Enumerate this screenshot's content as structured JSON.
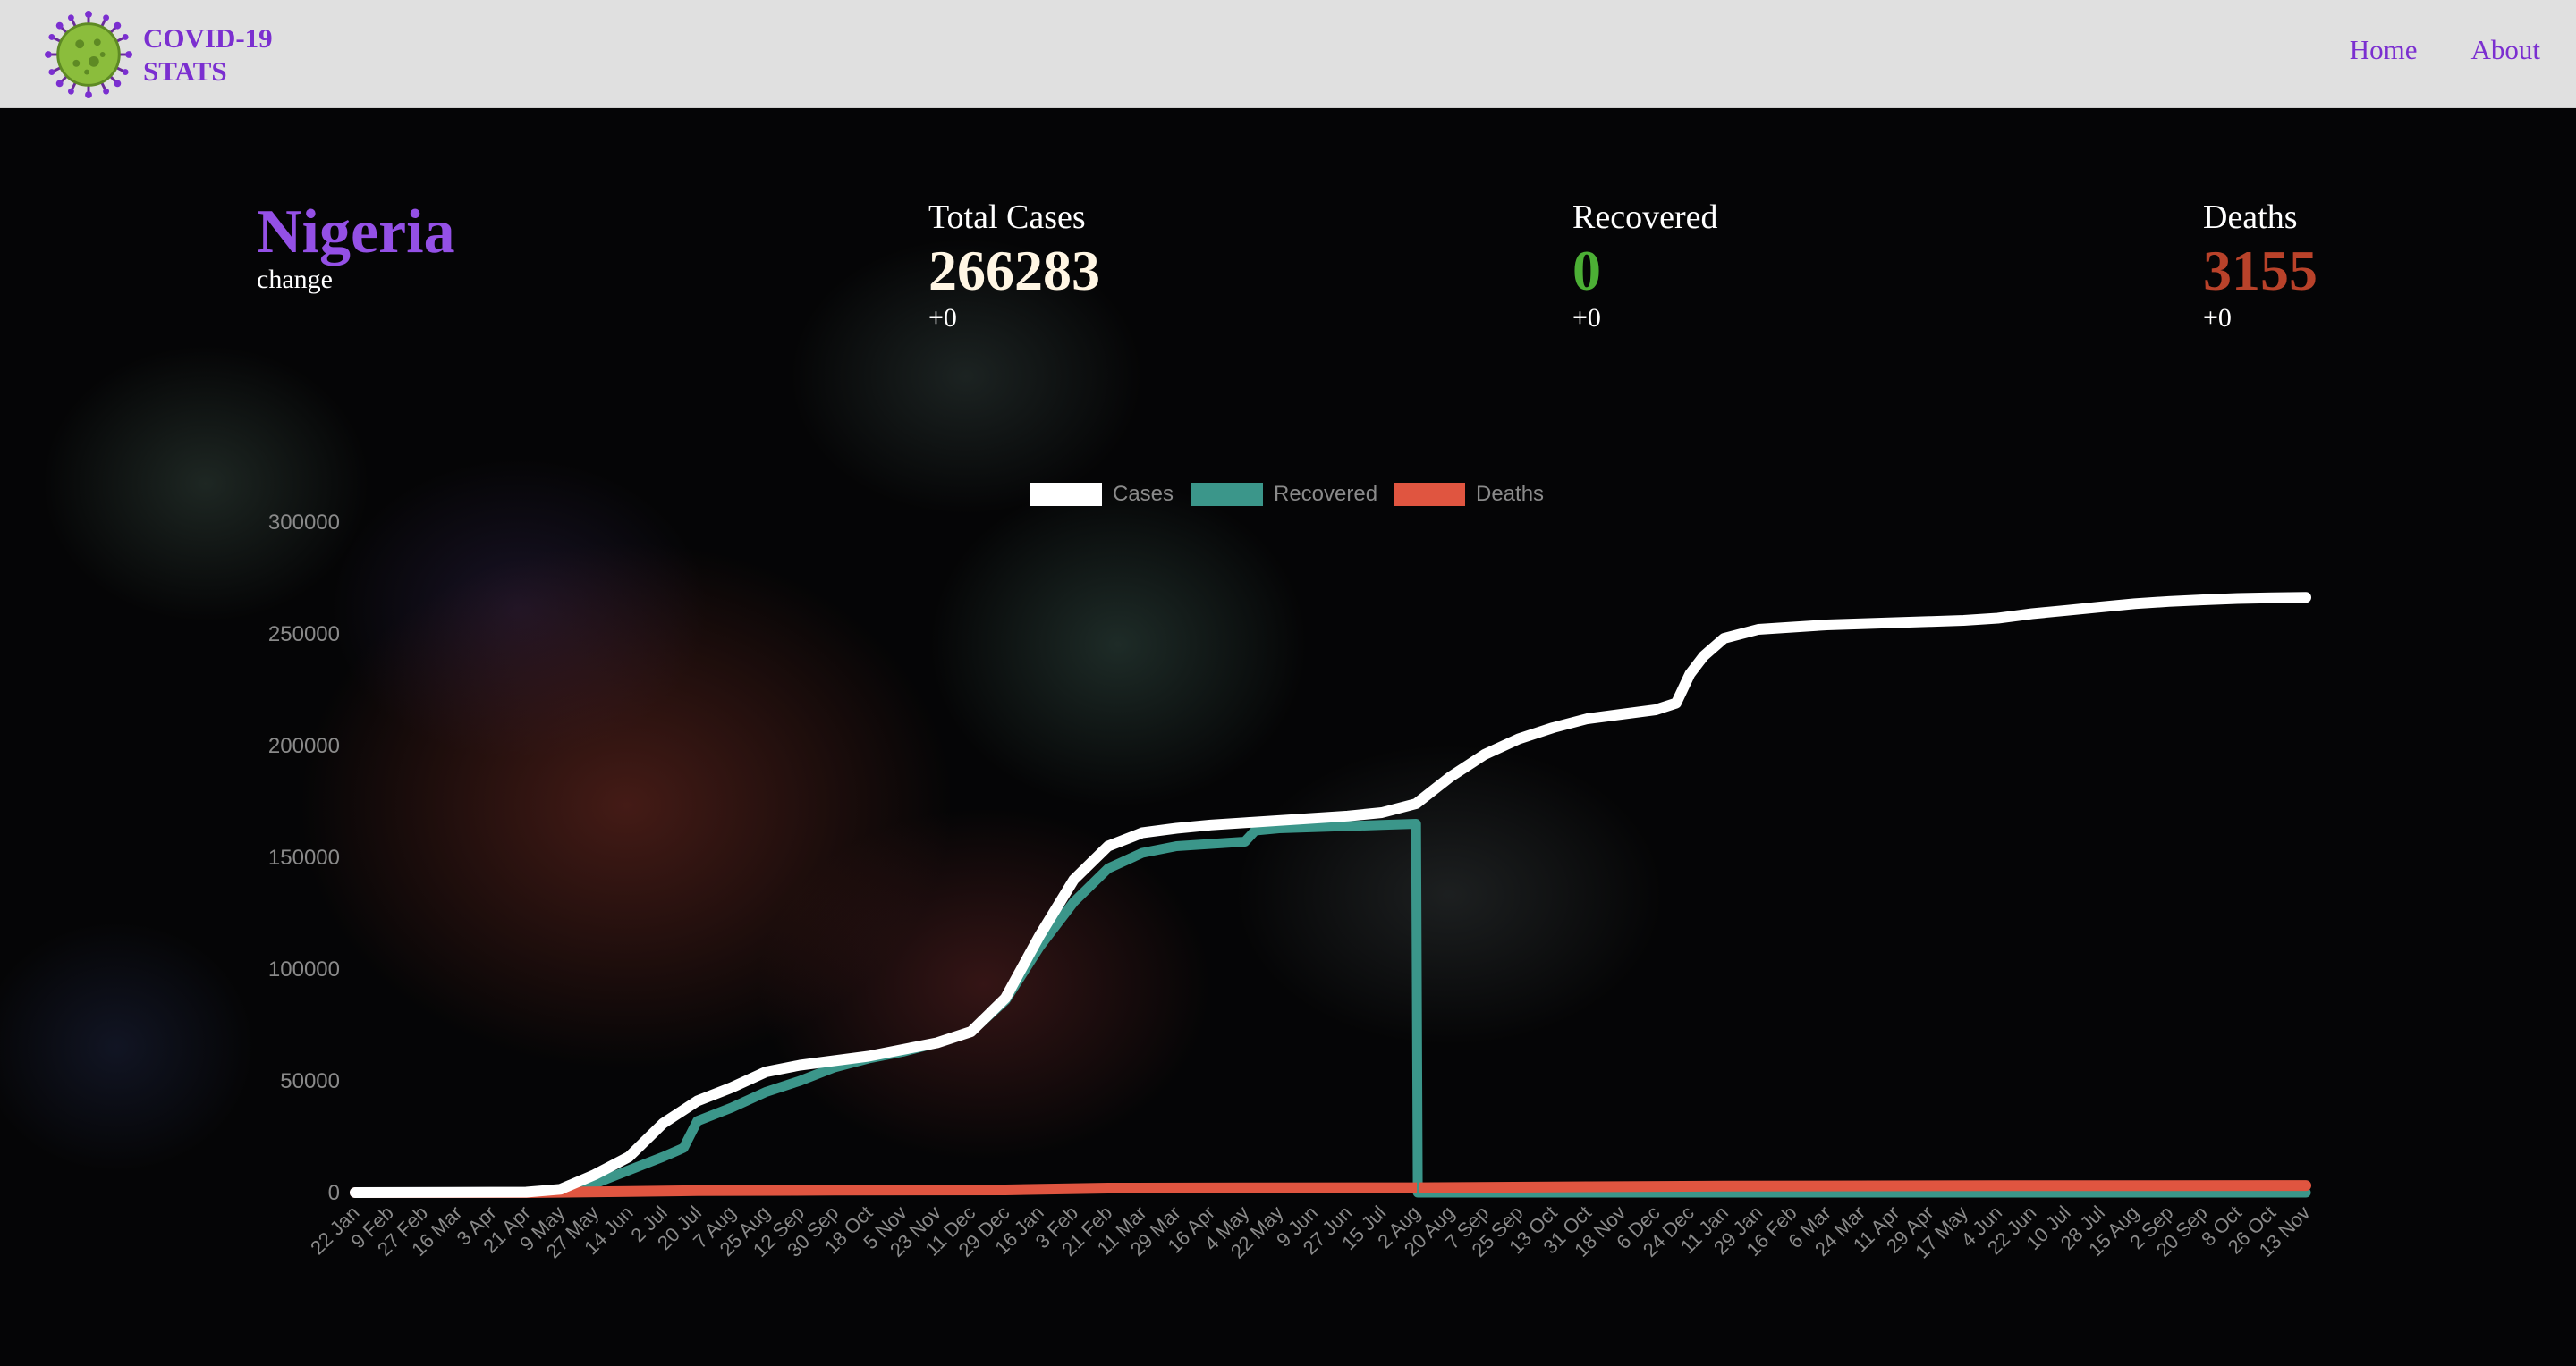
{
  "navbar": {
    "brand_line1": "COVID-19",
    "brand_line2": "STATS",
    "links": [
      "Home",
      "About"
    ]
  },
  "country": {
    "name": "Nigeria",
    "change_label": "change"
  },
  "stats": {
    "cases": {
      "label": "Total Cases",
      "value": "266283",
      "delta": "+0"
    },
    "recovered": {
      "label": "Recovered",
      "value": "0",
      "delta": "+0"
    },
    "deaths": {
      "label": "Deaths",
      "value": "3155",
      "delta": "+0"
    }
  },
  "colors": {
    "brand": "#7b2fd0",
    "cases": "#ffffff",
    "recovered": "#3b968a",
    "deaths": "#e05540"
  },
  "chart_data": {
    "type": "line",
    "grid": false,
    "legend_position": "top",
    "ylim": [
      0,
      300000
    ],
    "yticks": [
      0,
      50000,
      100000,
      150000,
      200000,
      250000,
      300000
    ],
    "xticks": [
      "22 Jan",
      "9 Feb",
      "27 Feb",
      "16 Mar",
      "3 Apr",
      "21 Apr",
      "9 May",
      "27 May",
      "14 Jun",
      "2 Jul",
      "20 Jul",
      "7 Aug",
      "25 Aug",
      "12 Sep",
      "30 Sep",
      "18 Oct",
      "5 Nov",
      "23 Nov",
      "11 Dec",
      "29 Dec",
      "16 Jan",
      "3 Feb",
      "21 Feb",
      "11 Mar",
      "29 Mar",
      "16 Apr",
      "4 May",
      "22 May",
      "9 Jun",
      "27 Jun",
      "15 Jul",
      "2 Aug",
      "20 Aug",
      "7 Sep",
      "25 Sep",
      "13 Oct",
      "31 Oct",
      "18 Nov",
      "6 Dec",
      "24 Dec",
      "11 Jan",
      "29 Jan",
      "16 Feb",
      "6 Mar",
      "24 Mar",
      "11 Apr",
      "29 Apr",
      "17 May",
      "4 Jun",
      "22 Jun",
      "10 Jul",
      "28 Jul",
      "15 Aug",
      "2 Sep",
      "20 Sep",
      "8 Oct",
      "26 Oct",
      "13 Nov"
    ],
    "series": [
      {
        "name": "Cases",
        "color": "#ffffff",
        "points": [
          [
            0,
            0
          ],
          [
            5,
            200
          ],
          [
            6,
            1500
          ],
          [
            7,
            8000
          ],
          [
            8,
            16000
          ],
          [
            9,
            31000
          ],
          [
            10,
            41000
          ],
          [
            11,
            47000
          ],
          [
            12,
            54000
          ],
          [
            13,
            57000
          ],
          [
            14,
            59000
          ],
          [
            15,
            61000
          ],
          [
            16,
            64000
          ],
          [
            17,
            67000
          ],
          [
            18,
            72000
          ],
          [
            19,
            87000
          ],
          [
            20,
            115000
          ],
          [
            21,
            140000
          ],
          [
            22,
            155000
          ],
          [
            23,
            161000
          ],
          [
            24,
            163000
          ],
          [
            25,
            164500
          ],
          [
            26,
            165500
          ],
          [
            27,
            166500
          ],
          [
            28,
            167500
          ],
          [
            29,
            168500
          ],
          [
            30,
            170000
          ],
          [
            31,
            174000
          ],
          [
            32,
            186000
          ],
          [
            33,
            196000
          ],
          [
            34,
            203000
          ],
          [
            35,
            208000
          ],
          [
            36,
            212000
          ],
          [
            37,
            214000
          ],
          [
            38,
            216000
          ],
          [
            38.6,
            219000
          ],
          [
            39,
            232000
          ],
          [
            39.4,
            240000
          ],
          [
            40,
            248000
          ],
          [
            41,
            252000
          ],
          [
            42,
            253000
          ],
          [
            43,
            254000
          ],
          [
            44,
            254500
          ],
          [
            45,
            255000
          ],
          [
            46,
            255500
          ],
          [
            47,
            256000
          ],
          [
            48,
            257000
          ],
          [
            49,
            259000
          ],
          [
            50,
            260500
          ],
          [
            51,
            262000
          ],
          [
            52,
            263500
          ],
          [
            53,
            264500
          ],
          [
            54,
            265200
          ],
          [
            55,
            265800
          ],
          [
            56,
            266100
          ],
          [
            57,
            266283
          ]
        ]
      },
      {
        "name": "Recovered",
        "color": "#3b968a",
        "points": [
          [
            0,
            0
          ],
          [
            5,
            0
          ],
          [
            6,
            800
          ],
          [
            7,
            4000
          ],
          [
            8,
            10000
          ],
          [
            9,
            16000
          ],
          [
            9.6,
            20000
          ],
          [
            10,
            32000
          ],
          [
            11,
            38000
          ],
          [
            12,
            45000
          ],
          [
            13,
            50000
          ],
          [
            14,
            56000
          ],
          [
            15,
            60000
          ],
          [
            16,
            63000
          ],
          [
            17,
            67000
          ],
          [
            18,
            72000
          ],
          [
            19,
            86000
          ],
          [
            20,
            110000
          ],
          [
            21,
            130000
          ],
          [
            22,
            145000
          ],
          [
            23,
            152000
          ],
          [
            24,
            155000
          ],
          [
            25,
            156000
          ],
          [
            26,
            157000
          ],
          [
            26.3,
            162000
          ],
          [
            27,
            163000
          ],
          [
            28,
            163500
          ],
          [
            29,
            164000
          ],
          [
            30,
            164500
          ],
          [
            31,
            165000
          ],
          [
            31.05,
            0
          ],
          [
            57,
            0
          ]
        ]
      },
      {
        "name": "Deaths",
        "color": "#e05540",
        "points": [
          [
            0,
            0
          ],
          [
            5,
            20
          ],
          [
            8,
            500
          ],
          [
            10,
            900
          ],
          [
            14,
            1100
          ],
          [
            19,
            1200
          ],
          [
            22,
            2000
          ],
          [
            26,
            2100
          ],
          [
            31,
            2150
          ],
          [
            36,
            2600
          ],
          [
            40,
            2900
          ],
          [
            48,
            3100
          ],
          [
            57,
            3155
          ]
        ]
      }
    ]
  }
}
